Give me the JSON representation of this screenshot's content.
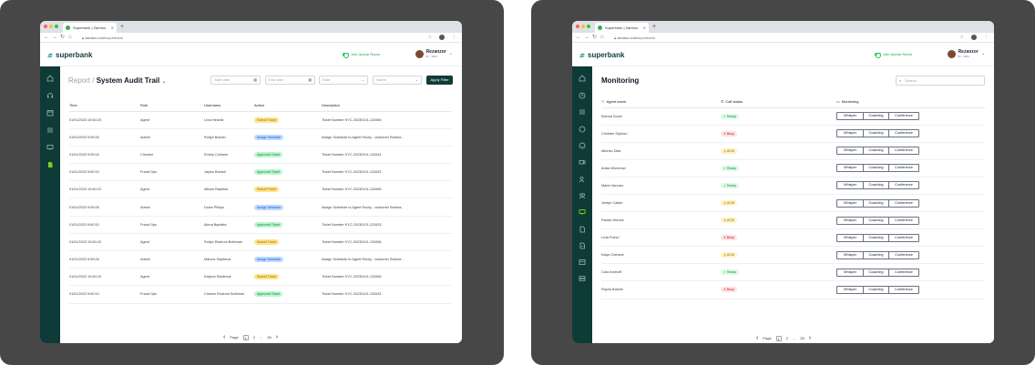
{
  "left": {
    "browser": {
      "tab_title": "Superbank | Zamtoo",
      "url_domain": "zamtoo.com",
      "url_path": "/superbank"
    },
    "header": {
      "brand": "superbank",
      "queue_label": "Join Queue Room",
      "user_name": "Rezanzor",
      "user_role": "ID - 1041"
    },
    "page": {
      "breadcrumb": "Report",
      "separator": "/",
      "title": "System Audit Trail",
      "filters": {
        "start_date": "Start date",
        "end_date": "End date",
        "role": "Role",
        "name": "Name",
        "apply": "Apply Filter"
      }
    },
    "table": {
      "columns": [
        "Time",
        "Role",
        "Usernams",
        "Action",
        "Description"
      ],
      "rows": [
        {
          "time": "01/01/2023 10:60:23",
          "role": "Agent",
          "user": "Livia Herwitz",
          "action": "Submit Ticket",
          "action_type": "sub",
          "desc": "Ticket Number KYC-20230101-123456"
        },
        {
          "time": "01/01/2023 9:59:26",
          "role": "Admin",
          "user": "Roltyn Botosh",
          "action": "Assign Schedule",
          "action_type": "asg",
          "desc": "Assign Schedule to Agent Rocky - customer Rahma..."
        },
        {
          "time": "01/01/2023 9:59:16",
          "role": "Checker",
          "user": "Emery Culhane",
          "action": "Approved Ticket",
          "action_type": "app",
          "desc": "Ticket Number KYC-20230101-123444"
        },
        {
          "time": "01/01/2023 9:60:10",
          "role": "Fraud Ops",
          "user": "Jaylon Botosh",
          "action": "Approved Ticket",
          "action_type": "app",
          "desc": "Ticket Number KYC-20230101-123433"
        },
        {
          "time": "01/01/2023 10:60:23",
          "role": "Agent",
          "user": "Allison Baptista",
          "action": "Submit Ticket",
          "action_type": "sub",
          "desc": "Ticket Number KYC-20230101-123456"
        },
        {
          "time": "01/01/2023 9:59:26",
          "role": "Admin",
          "user": "Dulce Philips",
          "action": "Assign Schedule",
          "action_type": "asg",
          "desc": "Assign Schedule to Agent Rocky - customer Rahma..."
        },
        {
          "time": "01/01/2023 9:60:10",
          "role": "Fraud Ops",
          "user": "Alena Baptista",
          "action": "Approved Ticket",
          "action_type": "app",
          "desc": "Ticket Number KYC-20230101-123433"
        },
        {
          "time": "01/01/2023 10:60:23",
          "role": "Agent",
          "user": "Roltyn Ekstrom Bothman",
          "action": "Submit Ticket",
          "action_type": "sub",
          "desc": "Ticket Number KYC-20230101-123456"
        },
        {
          "time": "01/01/2023 9:59:26",
          "role": "Admin",
          "user": "Marcus Septimus",
          "action": "Assign Schedule",
          "action_type": "asg",
          "desc": "Assign Schedule to Agent Rocky - customer Rahma..."
        },
        {
          "time": "01/01/2023 10:60:23",
          "role": "Agent",
          "user": "Kaiyum Septimus",
          "action": "Submit Ticket",
          "action_type": "sub",
          "desc": "Ticket Number KYC-20230101-123456"
        },
        {
          "time": "01/01/2023 9:60:10",
          "role": "Fraud Ops",
          "user": "Chance Ekstrom Bothman",
          "action": "Approved Ticket",
          "action_type": "app",
          "desc": "Ticket Number KYC-20230101-123433"
        }
      ]
    },
    "pager": {
      "label": "Page",
      "current": "1",
      "next": "2",
      "ellipsis": "...",
      "last": "28"
    }
  },
  "right": {
    "browser": {
      "tab_title": "Superbank | Zamtoo",
      "url_domain": "zamtoo.com",
      "url_path": "/superbank"
    },
    "header": {
      "brand": "superbank",
      "queue_label": "Join Queue Room",
      "user_name": "Rezanzor",
      "user_role": "ID - 1041"
    },
    "page": {
      "title": "Monitoring",
      "search_placeholder": "Search"
    },
    "table": {
      "columns": [
        "Agent name",
        "Call status",
        "Monitoring"
      ],
      "buttons": {
        "whisper": "Whisper",
        "coaching": "Coaching",
        "conference": "Conference"
      },
      "rows": [
        {
          "name": "Kianna Dorwi",
          "status": "Ready",
          "status_type": "ready"
        },
        {
          "name": "Cristofer Siphron",
          "status": "Busy",
          "status_type": "busy"
        },
        {
          "name": "Alfonso Dias",
          "status": "ACW",
          "status_type": "acw"
        },
        {
          "name": "Anika Workman",
          "status": "Ready",
          "status_type": "ready"
        },
        {
          "name": "Maria Vaccaro",
          "status": "Ready",
          "status_type": "ready"
        },
        {
          "name": "Jordyn Calder",
          "status": "ACW",
          "status_type": "acw"
        },
        {
          "name": "Randy Vetrovs",
          "status": "ACW",
          "status_type": "acw"
        },
        {
          "name": "Livia Franci",
          "status": "Busy",
          "status_type": "busy"
        },
        {
          "name": "Kaiya Culhane",
          "status": "ACW",
          "status_type": "acw"
        },
        {
          "name": "Cara Aminoff",
          "status": "Ready",
          "status_type": "ready"
        },
        {
          "name": "Rayna Botosh",
          "status": "Busy",
          "status_type": "busy"
        }
      ]
    },
    "pager": {
      "label": "Page",
      "current": "1",
      "next": "2",
      "ellipsis": "...",
      "last": "28"
    }
  },
  "colors": {
    "sidebar": "#0e3b37",
    "accent": "#0f3b3a",
    "ready": "#15803d",
    "busy": "#b91c1c",
    "acw": "#a16207"
  },
  "icons": [
    "home-icon",
    "headset-icon",
    "calendar-icon",
    "list-icon",
    "monitor-icon",
    "document-icon",
    "search-icon",
    "chevron-down-icon",
    "calendar-icon",
    "user-icon",
    "phone-icon",
    "monitor-icon"
  ]
}
